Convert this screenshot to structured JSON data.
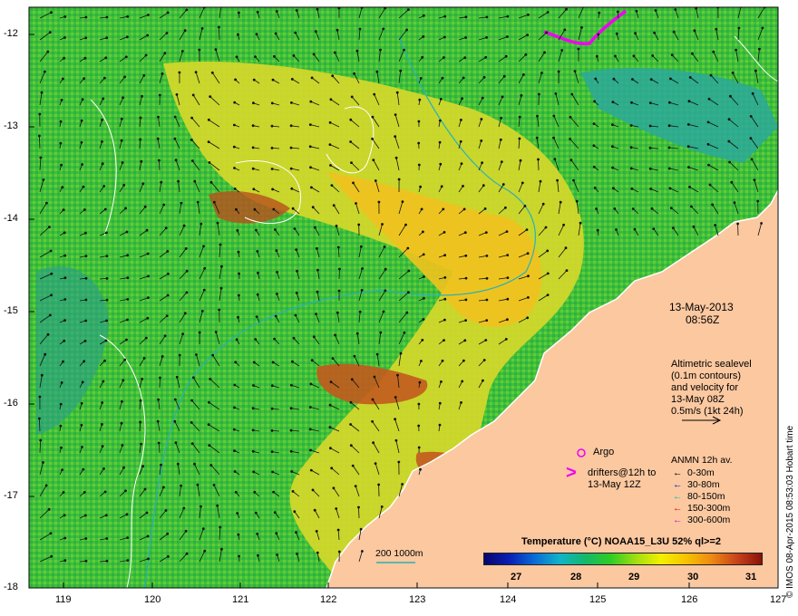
{
  "map": {
    "lon_ticks": [
      "119",
      "120",
      "121",
      "122",
      "123",
      "124",
      "125",
      "126",
      "127"
    ],
    "lat_ticks": [
      "-12",
      "-13",
      "-14",
      "-15",
      "-16",
      "-17",
      "-18"
    ],
    "colors": {
      "land": "#fbc8a0",
      "coast": "#ffffff",
      "contour": "#e8f4e8",
      "iso200": "#2ab0b6",
      "vector": "#111111",
      "border": "#000000"
    }
  },
  "annotations": {
    "date": "13-May-2013",
    "time": "08:56Z",
    "alt_lines": [
      "Altimetric sealevel",
      "(0.1m contours)",
      "and velocity for",
      "13-May 08Z",
      "0.5m/s (1kt 24h)"
    ],
    "argo": "Argo",
    "drifter_symbol": ">",
    "drifter_lines": [
      "drifters@12h to",
      "13-May 12Z"
    ],
    "anmn_title": "ANMN 12h av.",
    "anmn": [
      {
        "label": "0-30m",
        "color": "#000000"
      },
      {
        "label": "30-80m",
        "color": "#0018c8"
      },
      {
        "label": "80-150m",
        "color": "#00c8c8"
      },
      {
        "label": "150-300m",
        "color": "#e81010"
      },
      {
        "label": "300-600m",
        "color": "#f000f0"
      }
    ],
    "depth_label": "200  1000m",
    "credit": "© IMOS 08-Apr-2015 08:53:03 Hobart time"
  },
  "colorbar": {
    "title": "Temperature (°C) NOAA15_L3U 52% ql>=2",
    "ticks": [
      "27",
      "28",
      "29",
      "30",
      "31"
    ]
  }
}
